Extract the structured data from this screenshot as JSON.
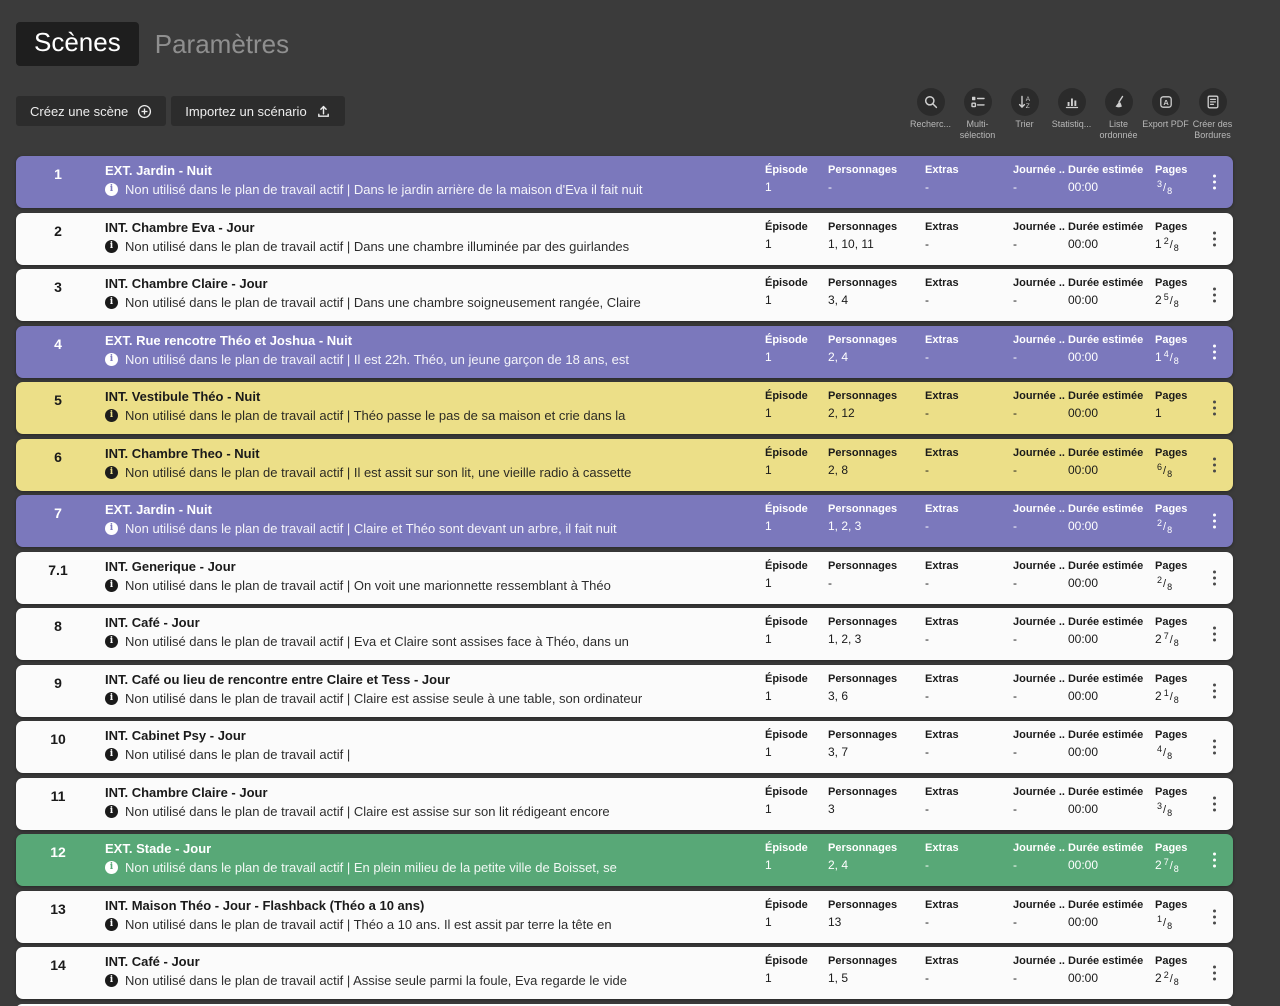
{
  "tabs": {
    "scenes": "Scènes",
    "parametres": "Paramètres"
  },
  "actions": {
    "create_scene": "Créez une scène",
    "import_scenario": "Importez un scénario"
  },
  "toolbar": {
    "items": [
      {
        "label": "Recherc...",
        "icon": "search-icon"
      },
      {
        "label": "Multi-sélection",
        "icon": "multi-select-icon"
      },
      {
        "label": "Trier",
        "icon": "sort-az-icon"
      },
      {
        "label": "Statistiq...",
        "icon": "bar-chart-icon"
      },
      {
        "label": "Liste ordonnée",
        "icon": "broom-icon"
      },
      {
        "label": "Export PDF",
        "icon": "pdf-file-icon"
      },
      {
        "label": "Créer des Bordures",
        "icon": "document-icon"
      }
    ]
  },
  "colors": {
    "purple": "#7b78bc",
    "yellow": "#ecdf88",
    "green": "#58a877",
    "white": "#fbfbfb",
    "background": "#3b3b3b"
  },
  "scenes": {
    "status_prefix": "Non utilisé dans le plan de travail actif",
    "columns": {
      "episode": "Épisode",
      "personnages": "Personnages",
      "extras": "Extras",
      "journee": "Journée ...",
      "duree": "Durée estimée",
      "pages": "Pages"
    },
    "rows": [
      {
        "num": "1",
        "color": "purple",
        "title": "EXT. Jardin - Nuit",
        "desc": "Dans le jardin arrière de la maison d'Eva il fait nuit",
        "episode": "1",
        "personnages": "-",
        "extras": "-",
        "journee": "-",
        "duree": "00:00",
        "pages": {
          "num": "3",
          "den": "8"
        }
      },
      {
        "num": "2",
        "color": "white",
        "title": "INT. Chambre Eva - Jour",
        "desc": "Dans une chambre illuminée par des guirlandes",
        "episode": "1",
        "personnages": "1, 10, 11",
        "extras": "-",
        "journee": "-",
        "duree": "00:00",
        "pages": {
          "whole": "1",
          "num": "2",
          "den": "8"
        }
      },
      {
        "num": "3",
        "color": "white",
        "title": "INT. Chambre Claire - Jour",
        "desc": "Dans une chambre soigneusement rangée, Claire",
        "episode": "1",
        "personnages": "3, 4",
        "extras": "-",
        "journee": "-",
        "duree": "00:00",
        "pages": {
          "whole": "2",
          "num": "5",
          "den": "8"
        }
      },
      {
        "num": "4",
        "color": "purple",
        "title": "EXT. Rue rencotre Théo et Joshua - Nuit",
        "desc": "Il est 22h. Théo, un jeune garçon de 18 ans, est",
        "episode": "1",
        "personnages": "2, 4",
        "extras": "-",
        "journee": "-",
        "duree": "00:00",
        "pages": {
          "whole": "1",
          "num": "4",
          "den": "8"
        }
      },
      {
        "num": "5",
        "color": "yellow",
        "title": "INT. Vestibule Théo - Nuit",
        "desc": "Théo passe le pas de sa maison et crie dans la",
        "episode": "1",
        "personnages": "2, 12",
        "extras": "-",
        "journee": "-",
        "duree": "00:00",
        "pages": {
          "whole": "1"
        }
      },
      {
        "num": "6",
        "color": "yellow",
        "title": "INT. Chambre Theo - Nuit",
        "desc": "Il est assit sur son lit, une vieille radio à cassette",
        "episode": "1",
        "personnages": "2, 8",
        "extras": "-",
        "journee": "-",
        "duree": "00:00",
        "pages": {
          "num": "6",
          "den": "8"
        }
      },
      {
        "num": "7",
        "color": "purple",
        "title": "EXT. Jardin - Nuit",
        "desc": "Claire et Théo sont devant un arbre, il fait nuit",
        "episode": "1",
        "personnages": "1, 2, 3",
        "extras": "-",
        "journee": "-",
        "duree": "00:00",
        "pages": {
          "num": "2",
          "den": "8"
        }
      },
      {
        "num": "7.1",
        "color": "white",
        "title": "INT. Generique - Jour",
        "desc": "On voit une marionnette ressemblant à Théo",
        "episode": "1",
        "personnages": "-",
        "extras": "-",
        "journee": "-",
        "duree": "00:00",
        "pages": {
          "num": "2",
          "den": "8"
        }
      },
      {
        "num": "8",
        "color": "white",
        "title": "INT. Café - Jour",
        "desc": "Eva et Claire sont assises face à Théo, dans un",
        "episode": "1",
        "personnages": "1, 2, 3",
        "extras": "-",
        "journee": "-",
        "duree": "00:00",
        "pages": {
          "whole": "2",
          "num": "7",
          "den": "8"
        }
      },
      {
        "num": "9",
        "color": "white",
        "title": "INT. Café ou lieu de rencontre entre Claire et Tess - Jour",
        "desc": "Claire est assise seule à une table, son ordinateur",
        "episode": "1",
        "personnages": "3, 6",
        "extras": "-",
        "journee": "-",
        "duree": "00:00",
        "pages": {
          "whole": "2",
          "num": "1",
          "den": "8"
        }
      },
      {
        "num": "10",
        "color": "white",
        "title": "INT. Cabinet Psy - Jour",
        "desc": "",
        "episode": "1",
        "personnages": "3, 7",
        "extras": "-",
        "journee": "-",
        "duree": "00:00",
        "pages": {
          "num": "4",
          "den": "8"
        }
      },
      {
        "num": "11",
        "color": "white",
        "title": "INT. Chambre Claire - Jour",
        "desc": "Claire est assise sur son lit rédigeant encore",
        "episode": "1",
        "personnages": "3",
        "extras": "-",
        "journee": "-",
        "duree": "00:00",
        "pages": {
          "num": "3",
          "den": "8"
        }
      },
      {
        "num": "12",
        "color": "green",
        "title": "EXT. Stade - Jour",
        "desc": "En plein milieu de la petite ville de Boisset, se",
        "episode": "1",
        "personnages": "2, 4",
        "extras": "-",
        "journee": "-",
        "duree": "00:00",
        "pages": {
          "whole": "2",
          "num": "7",
          "den": "8"
        }
      },
      {
        "num": "13",
        "color": "white",
        "title": "INT. Maison Théo - Jour - Flashback (Théo a 10 ans)",
        "desc": "Théo a 10 ans. Il est assit par terre la tête en",
        "episode": "1",
        "personnages": "13",
        "extras": "-",
        "journee": "-",
        "duree": "00:00",
        "pages": {
          "num": "1",
          "den": "8"
        }
      },
      {
        "num": "14",
        "color": "white",
        "title": "INT. Café - Jour",
        "desc": "Assise seule parmi la foule, Eva regarde le vide",
        "episode": "1",
        "personnages": "1, 5",
        "extras": "-",
        "journee": "-",
        "duree": "00:00",
        "pages": {
          "whole": "2",
          "num": "2",
          "den": "8"
        }
      }
    ]
  }
}
